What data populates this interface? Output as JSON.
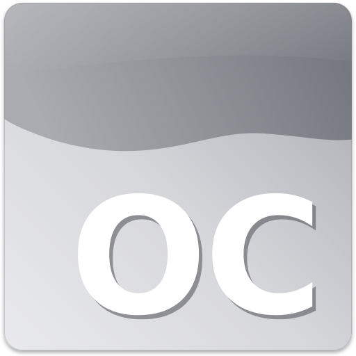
{
  "app_icon": {
    "monogram": "OC",
    "colors": {
      "top_dark": "#73757d",
      "top_light": "#a7a9ae",
      "body_light": "#e6e7ea",
      "body_mid": "#c6c7cc",
      "body_dark": "#9c9ea5",
      "text": "#ffffff",
      "text_shadow": "#4f5158"
    }
  }
}
